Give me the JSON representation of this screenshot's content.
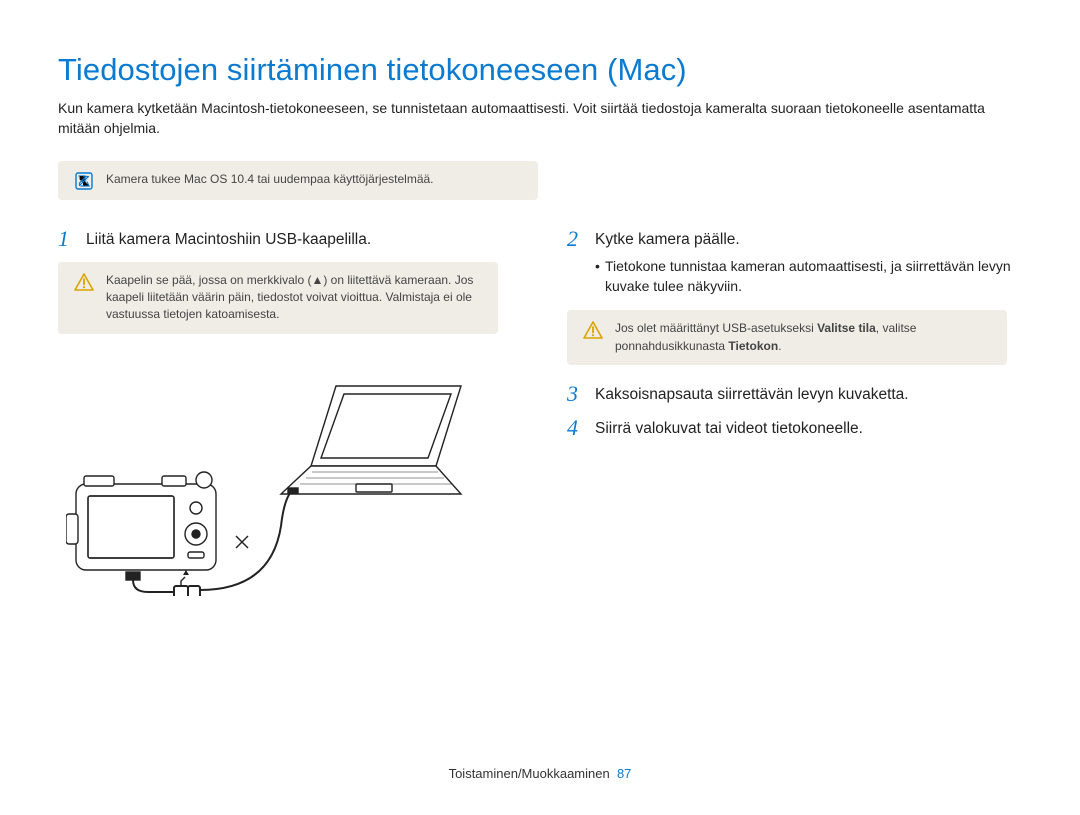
{
  "title": "Tiedostojen siirtäminen tietokoneeseen (Mac)",
  "intro": "Kun kamera kytketään Macintosh-tietokoneeseen, se tunnistetaan automaattisesti. Voit siirtää tiedostoja kameralta suoraan tietokoneelle asentamatta mitään ohjelmia.",
  "callout_os": "Kamera tukee Mac OS 10.4 tai uudempaa käyttöjärjestelmää.",
  "left": {
    "step1_num": "1",
    "step1_text": "Liitä kamera Macintoshiin USB-kaapelilla.",
    "warn_text": "Kaapelin se pää, jossa on merkkivalo (▲) on liitettävä kameraan. Jos kaapeli liitetään väärin päin, tiedostot voivat vioittua. Valmistaja ei ole vastuussa tietojen katoamisesta."
  },
  "right": {
    "step2_num": "2",
    "step2_text": "Kytke kamera päälle.",
    "step2_bullet": "Tietokone tunnistaa kameran automaattisesti, ja siirrettävän levyn kuvake tulee näkyviin.",
    "note_prefix": "Jos olet määrittänyt USB-asetukseksi ",
    "note_bold1": "Valitse tila",
    "note_mid": ", valitse ponnahdusikkunasta ",
    "note_bold2": "Tietokon",
    "note_suffix": ".",
    "step3_num": "3",
    "step3_text": "Kaksoisnapsauta siirrettävän levyn kuvaketta.",
    "step4_num": "4",
    "step4_text": "Siirrä valokuvat tai videot tietokoneelle."
  },
  "footer_section": "Toistaminen/Muokkaaminen",
  "footer_page": "87"
}
